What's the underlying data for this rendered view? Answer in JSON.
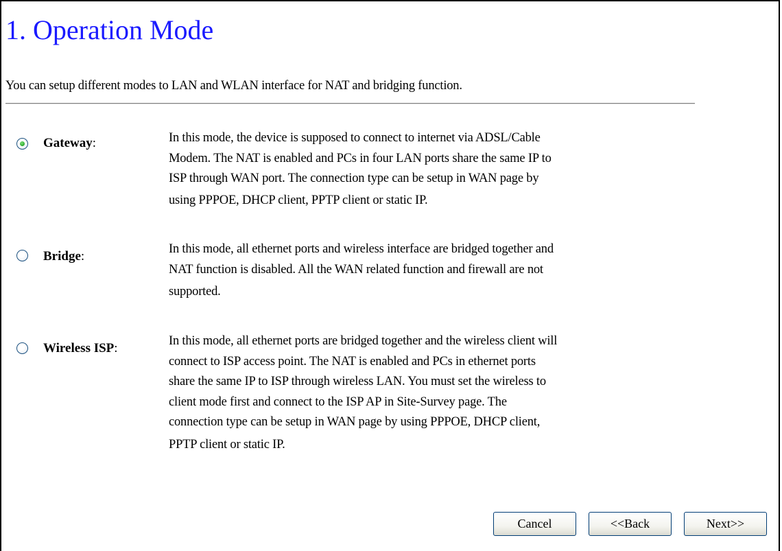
{
  "page": {
    "title": "1. Operation Mode",
    "intro": "You can setup different modes to LAN and WLAN interface for NAT and bridging function."
  },
  "modes": [
    {
      "label": "Gateway",
      "selected": true,
      "description": [
        "In this mode, the device is supposed to connect to internet via ADSL/Cable",
        "Modem. The NAT is enabled and PCs in four LAN ports share the same IP to",
        "ISP through WAN port. The connection type can be setup in WAN page by",
        "using PPPOE, DHCP client, PPTP client or static IP."
      ]
    },
    {
      "label": "Bridge",
      "selected": false,
      "description": [
        "In this mode, all ethernet ports and wireless interface are bridged together and",
        "NAT function is disabled. All the WAN related function and firewall are not",
        "supported."
      ]
    },
    {
      "label": "Wireless ISP",
      "selected": false,
      "description": [
        "In this mode, all ethernet ports are bridged together and the wireless client will",
        "connect to ISP access point. The NAT is enabled and PCs in ethernet ports",
        "share the same IP to ISP through wireless LAN. You must set the wireless to",
        "client mode first and connect to the ISP AP in Site-Survey page. The",
        "connection type can be setup in WAN page by using PPPOE, DHCP client,",
        "PPTP client or static IP."
      ]
    }
  ],
  "buttons": {
    "cancel": "Cancel",
    "back": "<<Back",
    "next": "Next>>"
  },
  "colors": {
    "title": "#1a1aff",
    "radio_selected": "#2aa92a",
    "button_border": "#003c74"
  }
}
